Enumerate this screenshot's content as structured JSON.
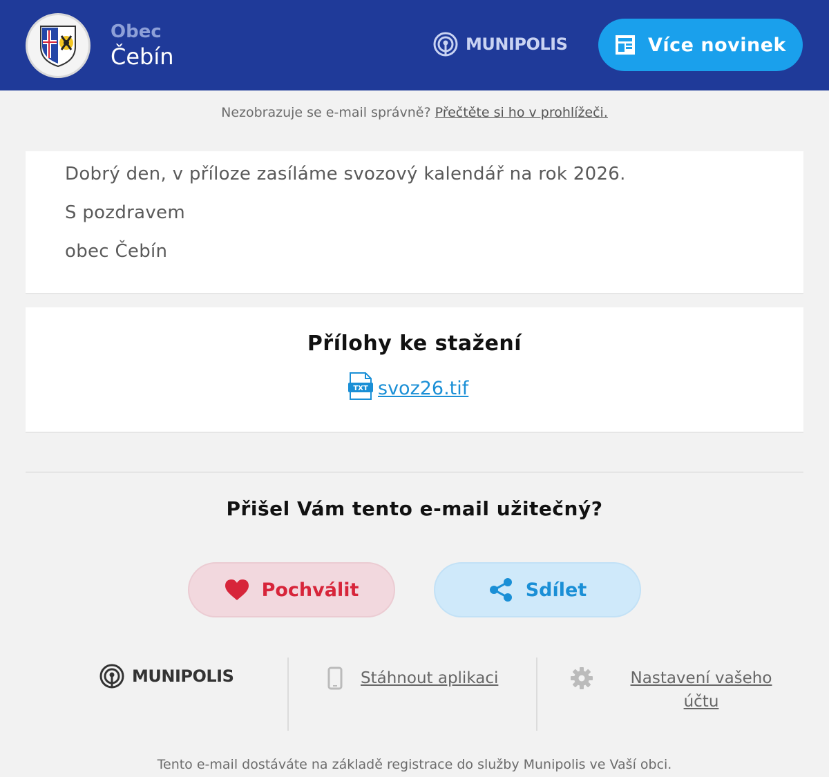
{
  "header": {
    "town_prefix": "Obec",
    "town_name": "Čebín",
    "brand": "MUNIPOLIS",
    "more_news_label": "Více novinek"
  },
  "notice": {
    "text": "Nezobrazuje se e-mail správně? ",
    "link": "Přečtěte si ho v prohlížeči."
  },
  "message": {
    "line1": "Dobrý den, v příloze zasíláme svozový kalendář na rok 2026.",
    "line2": "S pozdravem",
    "line3": "obec Čebín"
  },
  "attachments": {
    "title": "Přílohy ke stažení",
    "file_icon_text": "TXT",
    "file_name": "svoz26.tif"
  },
  "feedback": {
    "question": "Přišel Vám tento e-mail užitečný?",
    "praise_label": "Pochválit",
    "share_label": "Sdílet"
  },
  "footer": {
    "brand": "MUNIPOLIS",
    "download_app": "Stáhnout aplikaci",
    "settings_line1": "Nastavení vašeho",
    "settings_line2": "účtu",
    "note": "Tento e-mail dostáváte na základě registrace do služby Munipolis ve Vaší obci."
  },
  "colors": {
    "header_bg": "#1f3a99",
    "accent_blue": "#1aa0ec",
    "praise_red": "#d7253a",
    "page_bg": "#f2f2f2"
  }
}
